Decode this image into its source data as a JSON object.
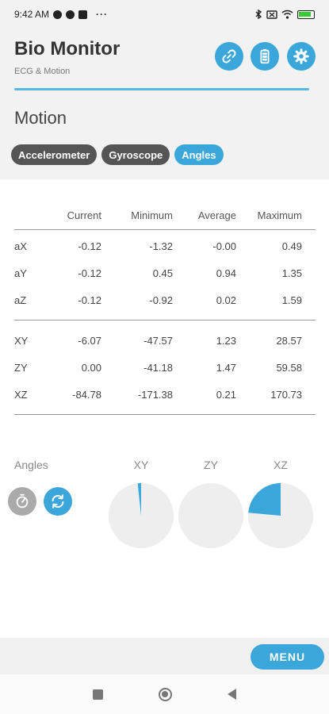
{
  "status_bar": {
    "time": "9:42 AM",
    "more": "···"
  },
  "header": {
    "title": "Bio Monitor",
    "subtitle": "ECG & Motion",
    "icons": [
      "link-icon",
      "battery-icon",
      "gear-icon"
    ]
  },
  "section": {
    "title": "Motion"
  },
  "tabs": [
    {
      "label": "Accelerometer",
      "active": false
    },
    {
      "label": "Gyroscope",
      "active": false
    },
    {
      "label": "Angles",
      "active": true
    }
  ],
  "table": {
    "headers": [
      "",
      "Current",
      "Minimum",
      "Average",
      "Maximum"
    ],
    "accel_rows": [
      [
        "aX",
        "-0.12",
        "-1.32",
        "-0.00",
        "0.49"
      ],
      [
        "aY",
        "-0.12",
        "0.45",
        "0.94",
        "1.35"
      ],
      [
        "aZ",
        "-0.12",
        "-0.92",
        "0.02",
        "1.59"
      ]
    ],
    "angle_rows": [
      [
        "XY",
        "-6.07",
        "-47.57",
        "1.23",
        "28.57"
      ],
      [
        "ZY",
        "0.00",
        "-41.18",
        "1.47",
        "59.58"
      ],
      [
        "XZ",
        "-84.78",
        "-171.38",
        "0.21",
        "170.73"
      ]
    ]
  },
  "angles": {
    "label": "Angles",
    "gauges": [
      {
        "label": "XY",
        "angle_deg": -6.07
      },
      {
        "label": "ZY",
        "angle_deg": 0.0
      },
      {
        "label": "XZ",
        "angle_deg": -84.78
      }
    ]
  },
  "menu_button": "MENU",
  "colors": {
    "accent": "#3aa6d9",
    "chip_inactive": "#555555",
    "gauge_bg": "#eeeeee"
  }
}
